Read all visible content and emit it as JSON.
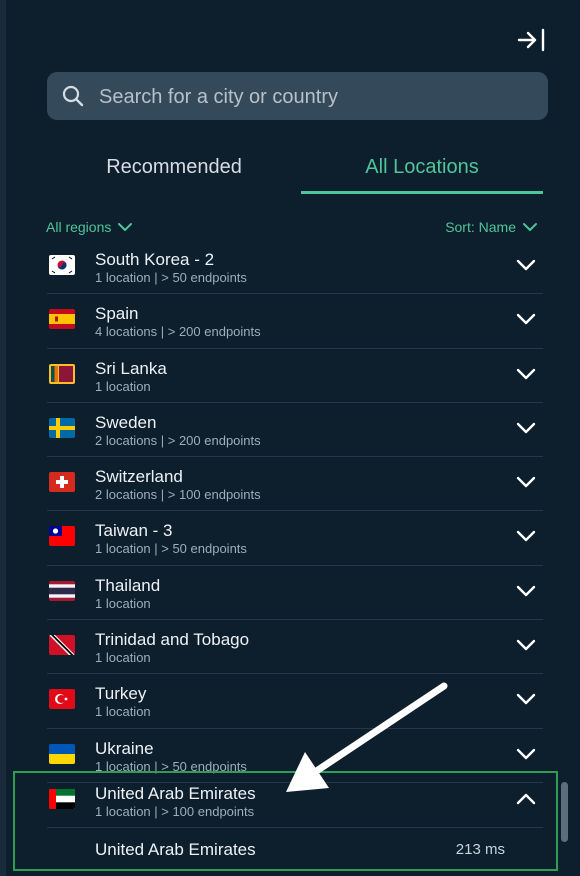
{
  "search": {
    "placeholder": "Search for a city or country"
  },
  "tabs": [
    {
      "label": "Recommended",
      "active": false
    },
    {
      "label": "All Locations",
      "active": true
    }
  ],
  "filters": {
    "region_label": "All regions",
    "sort_label": "Sort: Name"
  },
  "colors": {
    "accent": "#4fc59a",
    "background": "#0d1e2d",
    "highlight_border": "#2f9e54"
  },
  "locations": [
    {
      "name": "South Korea - 2",
      "detail": "1 location | > 50 endpoints",
      "flag_icon": "south-korea-flag-icon"
    },
    {
      "name": "Spain",
      "detail": "4 locations | > 200 endpoints",
      "flag_icon": "spain-flag-icon"
    },
    {
      "name": "Sri Lanka",
      "detail": "1 location",
      "flag_icon": "sri-lanka-flag-icon"
    },
    {
      "name": "Sweden",
      "detail": "2 locations | > 200 endpoints",
      "flag_icon": "sweden-flag-icon"
    },
    {
      "name": "Switzerland",
      "detail": "2 locations | > 100 endpoints",
      "flag_icon": "switzerland-flag-icon"
    },
    {
      "name": "Taiwan - 3",
      "detail": "1 location | > 50 endpoints",
      "flag_icon": "taiwan-flag-icon"
    },
    {
      "name": "Thailand",
      "detail": "1 location",
      "flag_icon": "thailand-flag-icon"
    },
    {
      "name": "Trinidad and Tobago",
      "detail": "1 location",
      "flag_icon": "trinidad-and-tobago-flag-icon"
    },
    {
      "name": "Turkey",
      "detail": "1 location",
      "flag_icon": "turkey-flag-icon"
    },
    {
      "name": "Ukraine",
      "detail": "1 location | > 50 endpoints",
      "flag_icon": "ukraine-flag-icon"
    }
  ],
  "expanded_location": {
    "name": "United Arab Emirates",
    "detail": "1 location | > 100 endpoints",
    "flag_icon": "uae-flag-icon",
    "cities": [
      {
        "name": "United Arab Emirates",
        "ping": "213 ms"
      }
    ]
  }
}
